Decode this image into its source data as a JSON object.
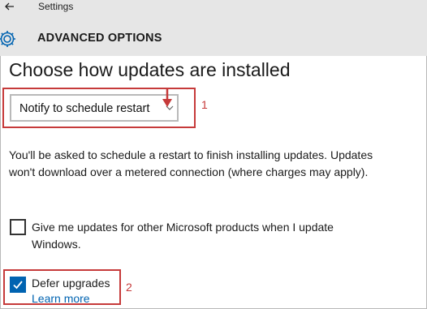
{
  "window": {
    "title": "Settings"
  },
  "header": {
    "title": "ADVANCED OPTIONS"
  },
  "main": {
    "heading": "Choose how updates are installed",
    "dropdown": {
      "selected": "Notify to schedule restart"
    },
    "description": "You'll be asked to schedule a restart to finish installing updates. Updates won't download over a metered connection (where charges may apply).",
    "checkbox_other_products": {
      "label": "Give me updates for other Microsoft products when I update Windows.",
      "checked": false
    },
    "checkbox_defer": {
      "label": "Defer upgrades",
      "checked": true
    },
    "learn_more": "Learn more"
  },
  "annotations": {
    "callout1": "1",
    "callout2": "2",
    "color": "#c63a3a"
  },
  "colors": {
    "accent": "#0063b1",
    "header_bg": "#e6e6e6"
  },
  "icons": [
    "back-arrow-icon",
    "gear-icon",
    "chevron-down-icon",
    "checkmark-icon",
    "red-down-arrow"
  ]
}
